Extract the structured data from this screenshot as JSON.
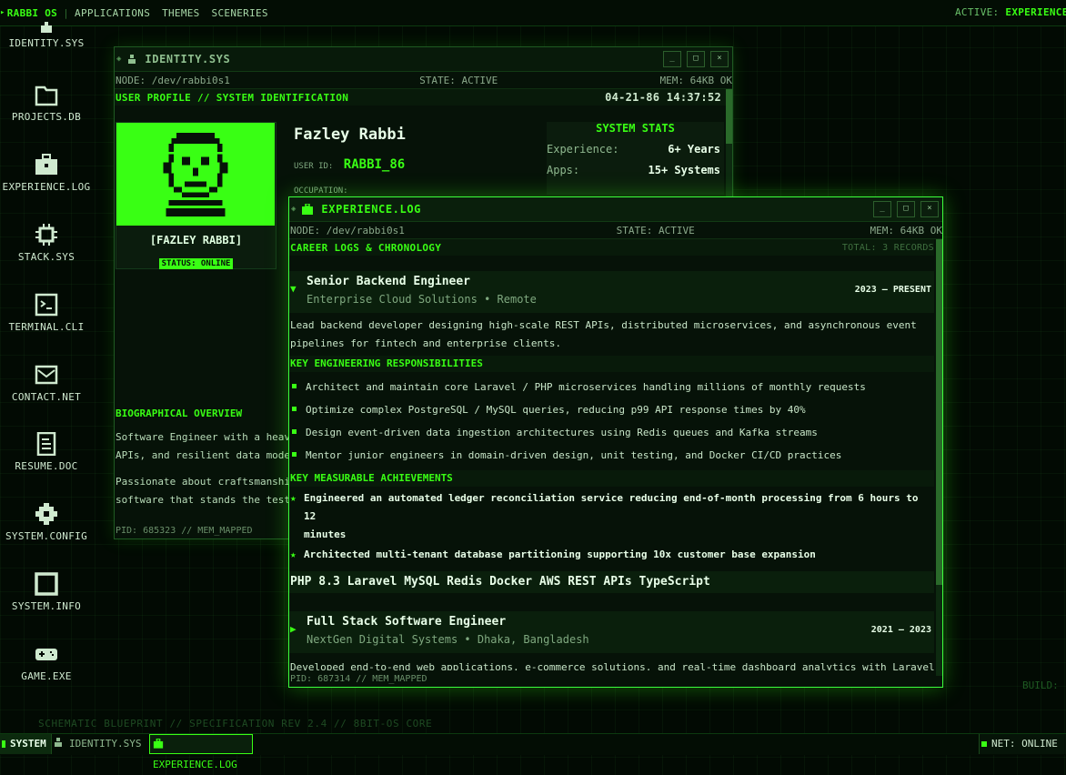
{
  "topbar": {
    "brand": "RABBI OS",
    "menu": [
      "APPLICATIONS",
      "THEMES",
      "SCENERIES"
    ],
    "active_label": "ACTIVE:",
    "active_value": "EXPERIENCE.LOG"
  },
  "desktop_icons": [
    {
      "label": "IDENTITY.SYS",
      "icon": "id-badge-icon"
    },
    {
      "label": "PROJECTS.DB",
      "icon": "folder-icon"
    },
    {
      "label": "EXPERIENCE.LOG",
      "icon": "briefcase-icon"
    },
    {
      "label": "STACK.SYS",
      "icon": "chip-icon"
    },
    {
      "label": "TERMINAL.CLI",
      "icon": "terminal-icon"
    },
    {
      "label": "CONTACT.NET",
      "icon": "mail-icon"
    },
    {
      "label": "RESUME.DOC",
      "icon": "document-icon"
    },
    {
      "label": "SYSTEM.CONFIG",
      "icon": "gear-icon"
    },
    {
      "label": "SYSTEM.INFO",
      "icon": "info-square-icon"
    },
    {
      "label": "GAME.EXE",
      "icon": "gamepad-icon"
    }
  ],
  "identity_window": {
    "title": "IDENTITY.SYS",
    "node": "NODE: /dev/rabbi0s1",
    "state": "STATE: ACTIVE",
    "mem": "MEM: 64KB OK",
    "section": "USER PROFILE // SYSTEM IDENTIFICATION",
    "datetime": "04-21-86 14:37:52",
    "avatar_name": "[FAZLEY RABBI]",
    "avatar_status": "STATUS: ONLINE",
    "name": "Fazley Rabbi",
    "user_id_label": "USER ID:",
    "user_id": "RABBI_86",
    "occupation_label": "OCCUPATION:",
    "stats_title": "SYSTEM STATS",
    "stats": [
      {
        "k": "Experience:",
        "v": "6+ Years"
      },
      {
        "k": "Apps:",
        "v": "15+ Systems"
      }
    ],
    "bio_title": "BIOGRAPHICAL OVERVIEW",
    "bio_1a": "Software Engineer with a heav",
    "bio_1b": "APIs, and resilient data mode",
    "bio_2a": "Passionate about craftsmanshi",
    "bio_2b": "software that stands the test",
    "footer": "PID: 685323 // MEM_MAPPED"
  },
  "experience_window": {
    "title": "EXPERIENCE.LOG",
    "node": "NODE: /dev/rabbi0s1",
    "state": "STATE: ACTIVE",
    "mem": "MEM: 64KB OK",
    "section": "CAREER LOGS & CHRONOLOGY",
    "total": "TOTAL: 3 RECORDS",
    "jobs": [
      {
        "title": "Senior Backend Engineer",
        "company": "Enterprise Cloud Solutions • Remote",
        "dates": "2023 — PRESENT",
        "summary_1": "Lead backend developer designing high-scale REST APIs, distributed microservices, and asynchronous event",
        "summary_2": "pipelines for fintech and enterprise clients.",
        "resp_title": "KEY ENGINEERING RESPONSIBILITIES",
        "responsibilities": [
          "Architect and maintain core Laravel / PHP microservices handling millions of monthly requests",
          "Optimize complex PostgreSQL / MySQL queries, reducing p99 API response times by 40%",
          "Design event-driven data ingestion architectures using Redis queues and Kafka streams",
          "Mentor junior engineers in domain-driven design, unit testing, and Docker CI/CD practices"
        ],
        "ach_title": "KEY MEASURABLE ACHIEVEMENTS",
        "ach_1a": "Engineered an automated ledger reconciliation service reducing end-of-month processing from 6 hours to 12",
        "ach_1b": "minutes",
        "ach_2": "Architected multi-tenant database partitioning supporting 10x customer base expansion",
        "tags": "PHP 8.3 Laravel MySQL Redis Docker AWS REST APIs TypeScript"
      },
      {
        "title": "Full Stack Software Engineer",
        "company": "NextGen Digital Systems • Dhaka, Bangladesh",
        "dates": "2021 — 2023",
        "summary_1": "Developed end-to-end web applications, e-commerce solutions, and real-time dashboard analytics with Laravel,"
      }
    ],
    "footer": "PID: 687314 // MEM_MAPPED"
  },
  "window_buttons": {
    "minimize": "_",
    "maximize": "□",
    "close": "×"
  },
  "background": {
    "blueprint": "SCHEMATIC BLUEPRINT // SPECIFICATION REV 2.4 // 8BIT-OS CORE",
    "build": "BUILD:"
  },
  "taskbar": {
    "start": "SYSTEM",
    "items": [
      "IDENTITY.SYS",
      "EXPERIENCE.LOG"
    ],
    "net": "NET: ONLINE"
  },
  "colors": {
    "accent": "#39ff14",
    "bg": "#020a03",
    "panel": "#061208"
  }
}
